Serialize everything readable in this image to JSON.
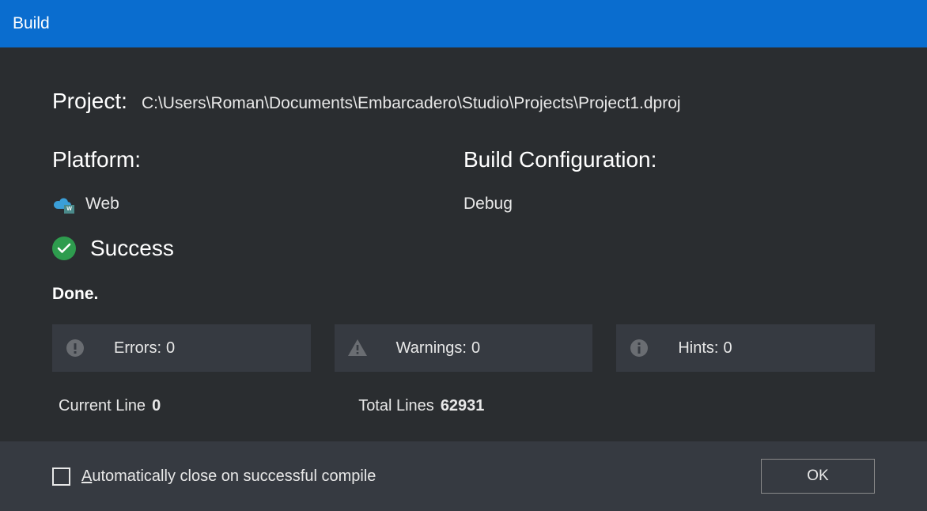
{
  "titlebar": {
    "title": "Build"
  },
  "project": {
    "label": "Project:",
    "path": "C:\\Users\\Roman\\Documents\\Embarcadero\\Studio\\Projects\\Project1.dproj"
  },
  "platform": {
    "heading": "Platform:",
    "value": "Web"
  },
  "buildConfig": {
    "heading": "Build Configuration:",
    "value": "Debug"
  },
  "status": {
    "text": "Success",
    "done": "Done."
  },
  "stats": {
    "errors": {
      "label": "Errors:",
      "value": "0"
    },
    "warnings": {
      "label": "Warnings:",
      "value": "0"
    },
    "hints": {
      "label": "Hints:",
      "value": "0"
    }
  },
  "lines": {
    "currentLabel": "Current Line",
    "currentValue": "0",
    "totalLabel": "Total Lines",
    "totalValue": "62931"
  },
  "footer": {
    "checkboxLabel": "utomatically close on successful compile",
    "checkboxAccel": "A",
    "okButton": "OK"
  }
}
